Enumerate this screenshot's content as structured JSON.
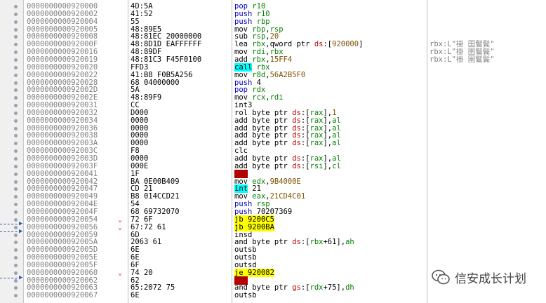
{
  "rows": [
    {
      "addr": "0000000000920000",
      "bytes": "4D:5A",
      "op": "pop",
      "args": "r10",
      "cmt": ""
    },
    {
      "addr": "0000000000920002",
      "bytes": "41:52",
      "op": "push",
      "args": "r10",
      "cmt": ""
    },
    {
      "addr": "0000000000920004",
      "bytes": "55",
      "op": "push",
      "args": "rbp",
      "cmt": ""
    },
    {
      "addr": "0000000000920005",
      "bytes": "48:89E5",
      "op": "mov",
      "args": "rbp,rsp",
      "cmt": ""
    },
    {
      "addr": "0000000000920008",
      "bytes": "48:81EC 20000000",
      "op": "sub",
      "args": "rsp,20",
      "cmt": ""
    },
    {
      "addr": "000000000092000F",
      "bytes": "48:8D1D EAFFFFFF",
      "op": "lea",
      "args": "rbx,qword ptr ds:[920000]",
      "cmt": "rbx:L\"褂 圉鬄鬓\""
    },
    {
      "addr": "0000000000920016",
      "bytes": "48:89DF",
      "op": "mov",
      "args": "rdi,rbx",
      "cmt": "rbx:L\"褂 圉鬄鬓\""
    },
    {
      "addr": "0000000000920019",
      "bytes": "48:81C3 F45F0100",
      "op": "add",
      "args": "rbx,15FF4",
      "cmt": "rbx:L\"褂 圉鬄鬓\""
    },
    {
      "addr": "0000000000920020",
      "bytes": "FFD3",
      "op": "call",
      "args": "rbx",
      "cmt": ""
    },
    {
      "addr": "0000000000920022",
      "bytes": "41:B8 F0B5A256",
      "op": "mov",
      "args": "r8d,56A2B5F0",
      "cmt": ""
    },
    {
      "addr": "0000000000920028",
      "bytes": "68 04000000",
      "op": "push",
      "args": "4",
      "cmt": ""
    },
    {
      "addr": "000000000092002D",
      "bytes": "5A",
      "op": "pop",
      "args": "rdx",
      "cmt": ""
    },
    {
      "addr": "000000000092002E",
      "bytes": "48:89F9",
      "op": "mov",
      "args": "rcx,rdi",
      "cmt": ""
    },
    {
      "addr": "0000000000920031",
      "bytes": "CC",
      "op": "int3",
      "args": "",
      "cmt": ""
    },
    {
      "addr": "0000000000920032",
      "bytes": "D000",
      "op": "rol",
      "args": "byte ptr ds:[rax],1",
      "cmt": ""
    },
    {
      "addr": "0000000000920034",
      "bytes": "0000",
      "op": "add",
      "args": "byte ptr ds:[rax],al",
      "cmt": ""
    },
    {
      "addr": "0000000000920036",
      "bytes": "0000",
      "op": "add",
      "args": "byte ptr ds:[rax],al",
      "cmt": ""
    },
    {
      "addr": "0000000000920038",
      "bytes": "0000",
      "op": "add",
      "args": "byte ptr ds:[rax],al",
      "cmt": ""
    },
    {
      "addr": "000000000092003A",
      "bytes": "0000",
      "op": "add",
      "args": "byte ptr ds:[rax],al",
      "cmt": ""
    },
    {
      "addr": "000000000092003C",
      "bytes": "F8",
      "op": "clc",
      "args": "",
      "cmt": ""
    },
    {
      "addr": "000000000092003D",
      "bytes": "0000",
      "op": "add",
      "args": "byte ptr ds:[rax],al",
      "cmt": ""
    },
    {
      "addr": "000000000092003F",
      "bytes": "000E",
      "op": "add",
      "args": "byte ptr ds:[rsi],cl",
      "cmt": ""
    },
    {
      "addr": "0000000000920041",
      "bytes": "1F",
      "op": "???",
      "args": "",
      "cmt": ""
    },
    {
      "addr": "0000000000920042",
      "bytes": "BA 0E00B409",
      "op": "mov",
      "args": "edx,9B4000E",
      "cmt": ""
    },
    {
      "addr": "0000000000920047",
      "bytes": "CD 21",
      "op": "int",
      "args": "21",
      "cmt": ""
    },
    {
      "addr": "0000000000920049",
      "bytes": "B8 014CCD21",
      "op": "mov",
      "args": "eax,21CD4C01",
      "cmt": ""
    },
    {
      "addr": "000000000092004E",
      "bytes": "54",
      "op": "push",
      "args": "rsp",
      "cmt": ""
    },
    {
      "addr": "000000000092004F",
      "bytes": "68 69732070",
      "op": "push",
      "args": "70207369",
      "cmt": ""
    },
    {
      "addr": "0000000000920054",
      "bytes": "72 6F",
      "op": "jb",
      "args": "9200C5",
      "cmt": ""
    },
    {
      "addr": "0000000000920056",
      "bytes": "67:72 61",
      "op": "jb",
      "args": "9200BA",
      "cmt": ""
    },
    {
      "addr": "0000000000920059",
      "bytes": "6D",
      "op": "insd",
      "args": "",
      "cmt": ""
    },
    {
      "addr": "000000000092005A",
      "bytes": "2063 61",
      "op": "and",
      "args": "byte ptr ds:[rbx+61],ah",
      "cmt": ""
    },
    {
      "addr": "000000000092005D",
      "bytes": "6E",
      "op": "outsb",
      "args": "",
      "cmt": ""
    },
    {
      "addr": "000000000092005E",
      "bytes": "6E",
      "op": "outsb",
      "args": "",
      "cmt": ""
    },
    {
      "addr": "000000000092005F",
      "bytes": "6F",
      "op": "outsd",
      "args": "",
      "cmt": ""
    },
    {
      "addr": "0000000000920060",
      "bytes": "74 20",
      "op": "je",
      "args": "920082",
      "cmt": ""
    },
    {
      "addr": "0000000000920062",
      "bytes": "62",
      "op": "???",
      "args": "",
      "cmt": ""
    },
    {
      "addr": "0000000000920063",
      "bytes": "65:2072 75",
      "op": "and",
      "args": "byte ptr gs:[rdx+75],dh",
      "cmt": ""
    },
    {
      "addr": "0000000000920067",
      "bytes": "6E",
      "op": "outsb",
      "args": "",
      "cmt": ""
    }
  ],
  "watermark": {
    "text": "信安成长计划"
  },
  "colors": {
    "call": "#00ffff",
    "jump": "#ffff00",
    "bad": "#b00000"
  }
}
